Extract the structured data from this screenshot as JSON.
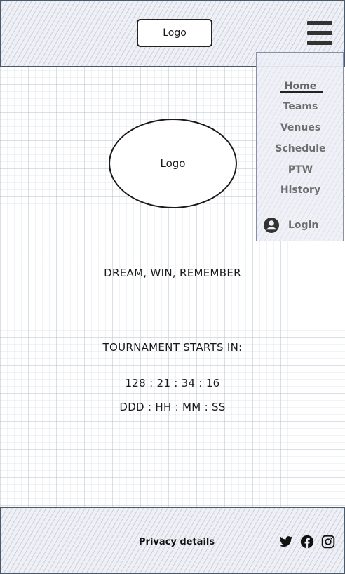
{
  "header": {
    "logo_text": "Logo"
  },
  "nav": {
    "items": [
      {
        "label": "Home",
        "active": true
      },
      {
        "label": "Teams"
      },
      {
        "label": "Venues"
      },
      {
        "label": "Schedule"
      },
      {
        "label": "PTW"
      },
      {
        "label": "History"
      }
    ],
    "login_label": "Login",
    "login_icon": "account-circle-icon"
  },
  "main": {
    "logo_text": "Logo",
    "tagline": "DREAM, WIN, REMEMBER",
    "countdown_heading": "TOURNAMENT STARTS IN:",
    "countdown_value": "128 : 21 : 34 : 16",
    "countdown_format": "DDD : HH : MM : SS"
  },
  "footer": {
    "privacy_label": "Privacy details",
    "social_icons": [
      "twitter-icon",
      "facebook-icon",
      "instagram-icon"
    ]
  }
}
